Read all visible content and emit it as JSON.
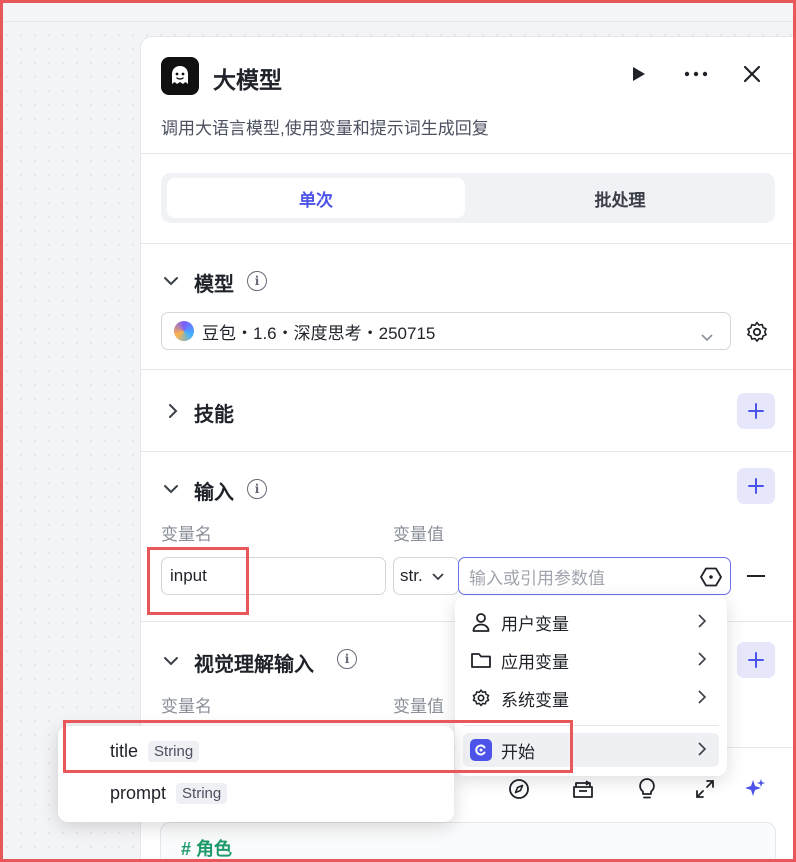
{
  "node": {
    "title": "大模型",
    "subtitle": "调用大语言模型,使用变量和提示词生成回复",
    "header_icons": [
      "play-icon",
      "more-icon",
      "close-icon"
    ]
  },
  "tabs": [
    {
      "label": "单次",
      "active": true
    },
    {
      "label": "批处理",
      "active": false
    }
  ],
  "model_section": {
    "title": "模型",
    "selected_model": "豆包・1.6・深度思考・250715"
  },
  "skills_section": {
    "title": "技能"
  },
  "input_section": {
    "title": "输入",
    "col_name": "变量名",
    "col_value": "变量值",
    "row": {
      "name": "input",
      "type_short": "str.",
      "value_placeholder": "输入或引用参数值"
    }
  },
  "visual_section": {
    "title": "视觉理解输入",
    "col_name": "变量名",
    "col_value": "变量值"
  },
  "reference_menu": {
    "items": [
      {
        "label": "用户变量",
        "icon": "user-icon"
      },
      {
        "label": "应用变量",
        "icon": "folder-icon"
      },
      {
        "label": "系统变量",
        "icon": "gear-icon"
      },
      {
        "label": "开始",
        "icon": "start-node-icon"
      }
    ]
  },
  "start_submenu": {
    "items": [
      {
        "name": "title",
        "type": "String"
      },
      {
        "name": "prompt",
        "type": "String"
      }
    ]
  },
  "prompt_editor": {
    "first_line": "# 角色",
    "toolbar_icons": [
      "compass-icon",
      "library-icon",
      "bulb-icon",
      "expand-icon",
      "sparkle-icon"
    ]
  },
  "colors": {
    "accent": "#4d53e8",
    "annotation_red": "#e8575a",
    "prompt_heading": "#1f9a6a"
  }
}
